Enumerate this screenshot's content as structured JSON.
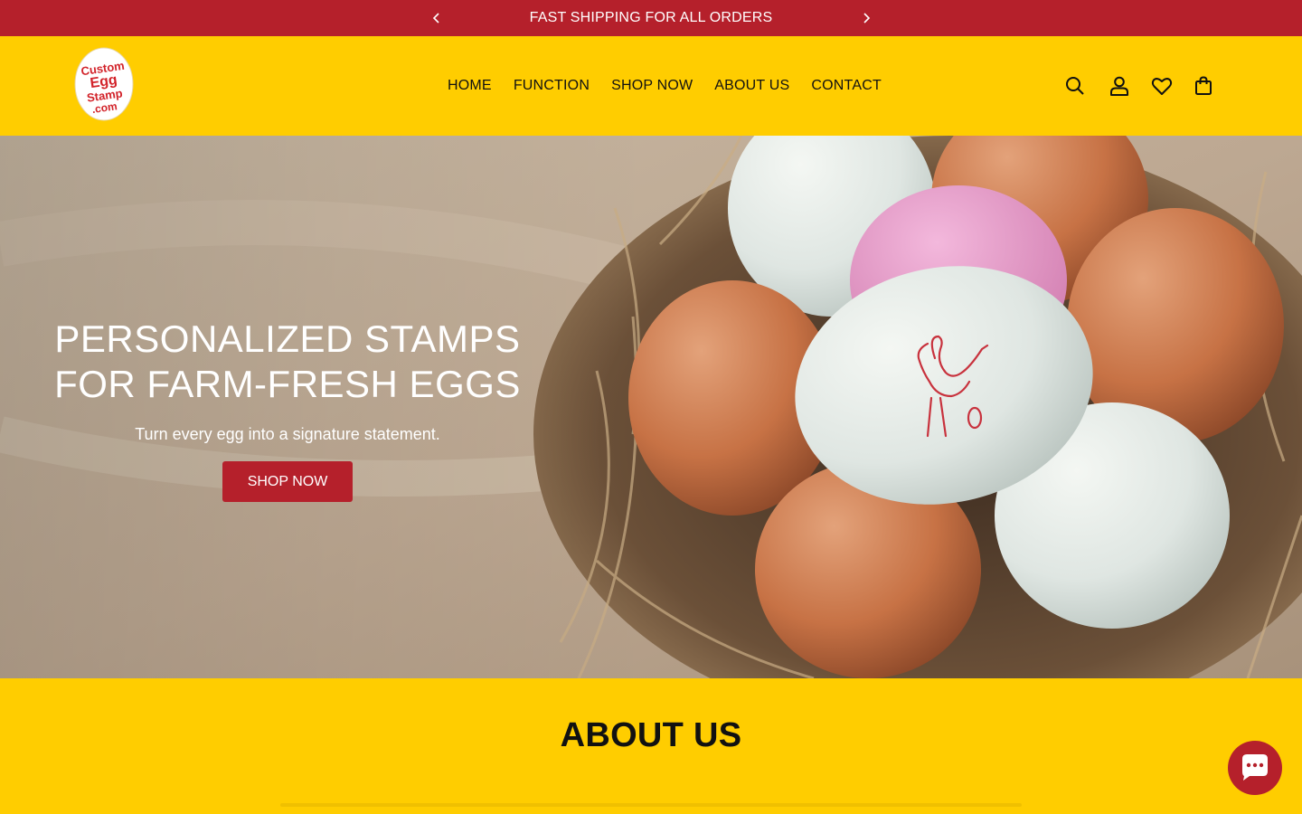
{
  "announcement": {
    "text": "FAST SHIPPING FOR ALL ORDERS",
    "prev_icon": "chevron-left-icon",
    "next_icon": "chevron-right-icon"
  },
  "header": {
    "logo_lines": [
      "Custom",
      "Egg",
      "Stamp",
      ".com"
    ],
    "nav": [
      {
        "label": "HOME"
      },
      {
        "label": "FUNCTION"
      },
      {
        "label": "SHOP NOW"
      },
      {
        "label": "ABOUT US"
      },
      {
        "label": "CONTACT"
      }
    ],
    "icons": [
      "search-icon",
      "account-icon",
      "wishlist-icon",
      "cart-icon"
    ]
  },
  "hero": {
    "title_line1": "PERSONALIZED STAMPS",
    "title_line2": "FOR FARM-FRESH EGGS",
    "subtitle": "Turn every egg into a signature statement.",
    "button": "SHOP NOW"
  },
  "about": {
    "heading": "ABOUT US"
  },
  "chat": {
    "icon": "chat-icon"
  },
  "colors": {
    "brand_red": "#b5202b",
    "brand_yellow": "#ffcd00"
  }
}
